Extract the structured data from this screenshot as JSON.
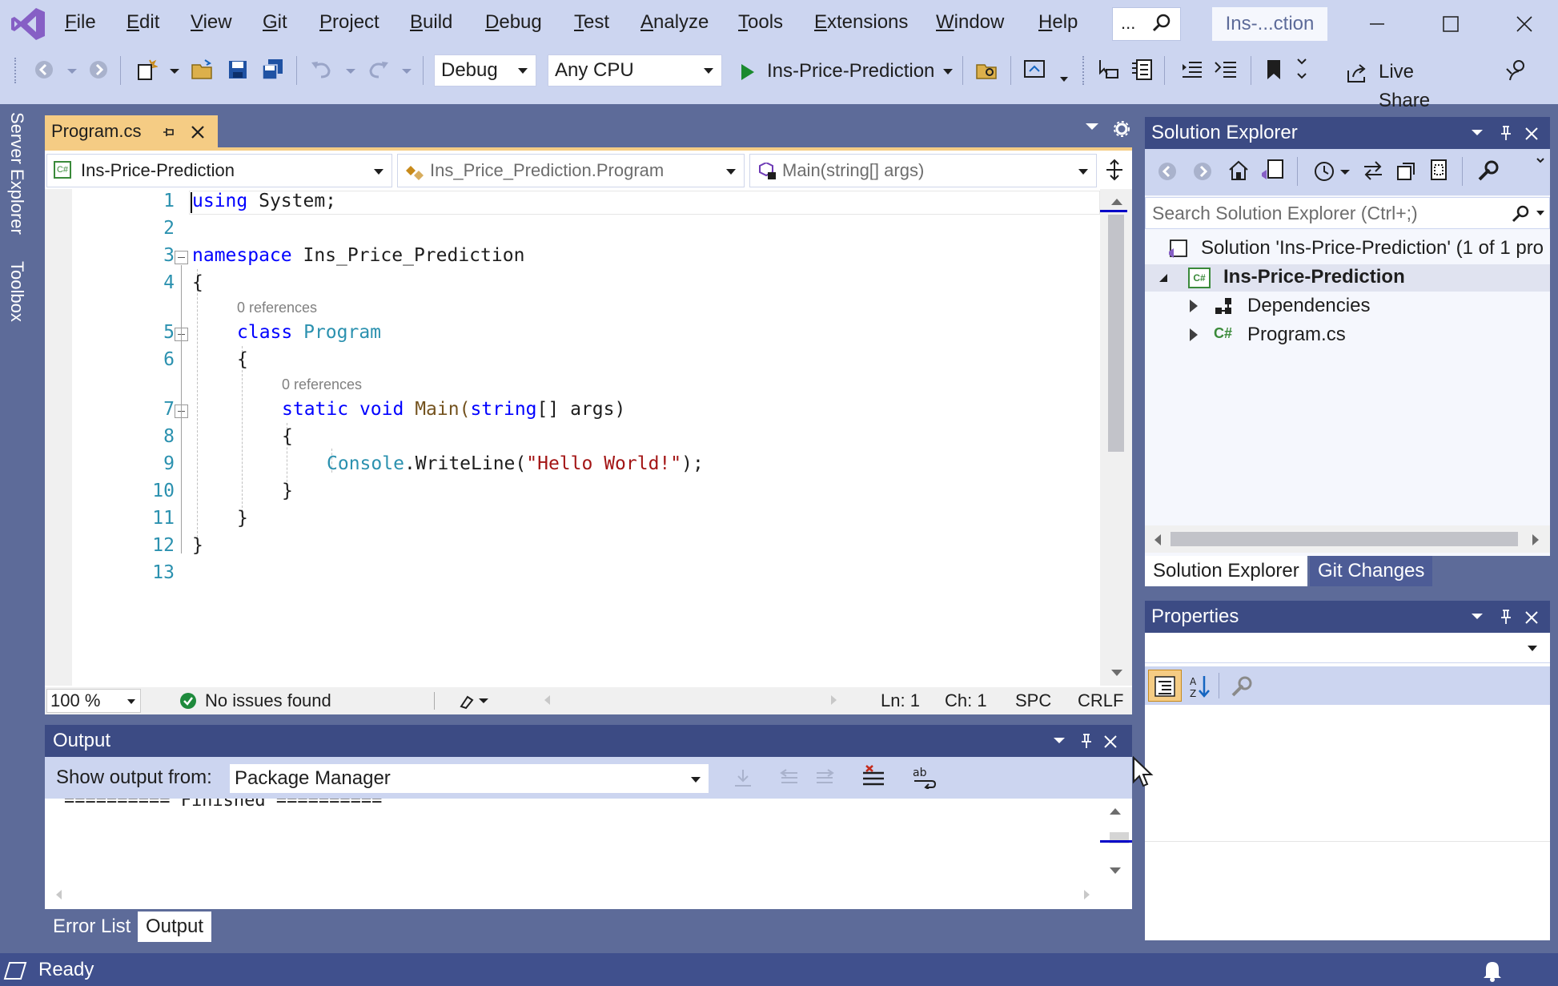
{
  "menu": [
    "File",
    "Edit",
    "View",
    "Git",
    "Project",
    "Build",
    "Debug",
    "Test",
    "Analyze",
    "Tools",
    "Extensions",
    "Window",
    "Help"
  ],
  "search": {
    "label": "..."
  },
  "window": {
    "title": "Ins-...ction"
  },
  "toolbar": {
    "config": "Debug",
    "platform": "Any CPU",
    "start_target": "Ins-Price-Prediction",
    "live_share": "Live Share"
  },
  "left_strip": {
    "server_explorer": "Server Explorer",
    "toolbox": "Toolbox"
  },
  "editor": {
    "tab_label": "Program.cs",
    "nav_project": "Ins-Price-Prediction",
    "nav_class": "Ins_Price_Prediction.Program",
    "nav_member": "Main(string[] args)",
    "line_numbers": [
      "1",
      "2",
      "3",
      "4",
      "5",
      "6",
      "7",
      "8",
      "9",
      "10",
      "11",
      "12",
      "13"
    ],
    "code": {
      "l1_kw": "using",
      "l1_rest": " System;",
      "l3_kw": "namespace",
      "l3_rest": " Ins_Price_Prediction",
      "l4": "{",
      "ref1": "0 references",
      "l5_kw": "class",
      "l5_type": " Program",
      "l6": "{",
      "ref2": "0 references",
      "l7_kw1": "static",
      "l7_kw2": " void",
      "l7_name": " Main(",
      "l7_kw3": "string",
      "l7_rest": "[] args)",
      "l8": "{",
      "l9_type": "Console",
      "l9_mid": ".WriteLine(",
      "l9_str": "\"Hello World!\"",
      "l9_end": ");",
      "l10": "}",
      "l11": "}",
      "l12": "}"
    },
    "zoom": "100 %",
    "issues": "No issues found",
    "ln": "Ln: 1",
    "ch": "Ch: 1",
    "spc": "SPC",
    "crlf": "CRLF"
  },
  "output": {
    "title": "Output",
    "show_from_label": "Show output from:",
    "source": "Package Manager",
    "text": "========== Finished =========="
  },
  "bottom_tabs": [
    "Error List",
    "Output"
  ],
  "solution_explorer": {
    "title": "Solution Explorer",
    "search_placeholder": "Search Solution Explorer (Ctrl+;)",
    "solution": "Solution 'Ins-Price-Prediction' (1 of 1 pro",
    "project": "Ins-Price-Prediction",
    "dependencies": "Dependencies",
    "file": "Program.cs",
    "tabs": [
      "Solution Explorer",
      "Git Changes"
    ]
  },
  "properties": {
    "title": "Properties"
  },
  "status": {
    "text": "Ready"
  },
  "colors": {
    "accent": "#3c4b84",
    "background": "#5d6b99",
    "tab_active": "#f5cc84",
    "vs_purple": "#865fc5"
  }
}
